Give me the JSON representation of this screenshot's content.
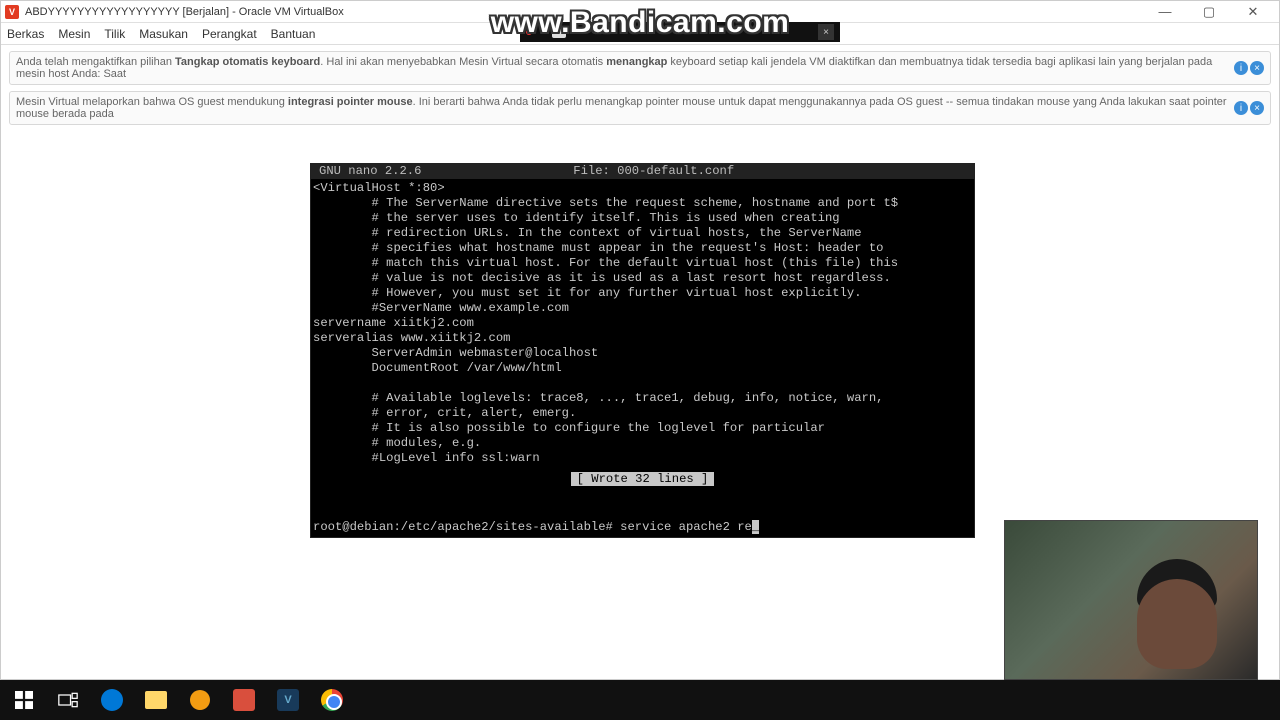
{
  "watermark": "www.Bandicam.com",
  "window": {
    "title": "ABDYYYYYYYYYYYYYYYYYY [Berjalan] - Oracle VM VirtualBox",
    "controls": {
      "min": "—",
      "max": "▢",
      "close": "✕"
    }
  },
  "menubar": {
    "berkas": "Berkas",
    "mesin": "Mesin",
    "tilik": "Tilik",
    "masukan": "Masukan",
    "perangkat": "Perangkat",
    "bantuan": "Bantuan"
  },
  "info1": {
    "pre": "Anda telah mengaktifkan pilihan ",
    "bold1": "Tangkap otomatis keyboard",
    "mid": ". Hal ini akan menyebabkan Mesin Virtual secara otomatis ",
    "bold2": "menangkap",
    "post": " keyboard setiap kali jendela VM diaktifkan dan membuatnya tidak tersedia bagi aplikasi lain yang berjalan pada mesin host Anda: Saat "
  },
  "info2": {
    "pre": "Mesin Virtual melaporkan bahwa OS guest mendukung ",
    "bold1": "integrasi pointer mouse",
    "post": ". Ini berarti bahwa Anda tidak perlu menangkap pointer mouse untuk dapat menggunakannya pada OS guest -- semua tindakan mouse yang Anda lakukan saat pointer mouse berada pada "
  },
  "nano": {
    "version": "GNU nano 2.2.6",
    "file_label": "File: 000-default.conf",
    "body": "<VirtualHost *:80>\n        # The ServerName directive sets the request scheme, hostname and port t$\n        # the server uses to identify itself. This is used when creating\n        # redirection URLs. In the context of virtual hosts, the ServerName\n        # specifies what hostname must appear in the request's Host: header to\n        # match this virtual host. For the default virtual host (this file) this\n        # value is not decisive as it is used as a last resort host regardless.\n        # However, you must set it for any further virtual host explicitly.\n        #ServerName www.example.com\nservername xiitkj2.com\nserveralias www.xiitkj2.com\n        ServerAdmin webmaster@localhost\n        DocumentRoot /var/www/html\n\n        # Available loglevels: trace8, ..., trace1, debug, info, notice, warn,\n        # error, crit, alert, emerg.\n        # It is also possible to configure the loglevel for particular\n        # modules, e.g.\n        #LogLevel info ssl:warn",
    "status": "[ Wrote 32 lines ]",
    "prompt": "root@debian:/etc/apache2/sites-available# service apache2 re",
    "cursor": "_"
  },
  "recbar": {
    "label": ""
  }
}
